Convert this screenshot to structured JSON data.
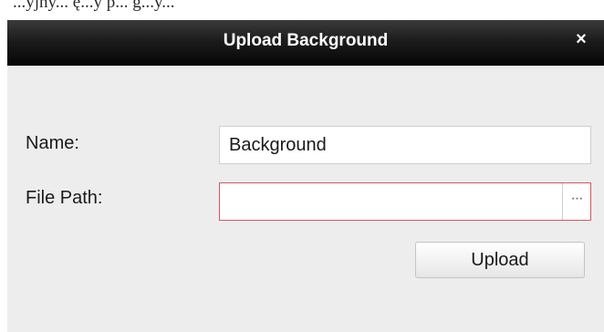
{
  "background_fragment": "...yjny... ę...y p... g...y...",
  "dialog": {
    "title": "Upload Background",
    "close_symbol": "×",
    "name_label": "Name:",
    "name_value": "Background",
    "file_path_label": "File Path:",
    "file_path_value": "",
    "browse_symbol": "···",
    "upload_label": "Upload",
    "colors": {
      "titlebar": "#0a0a0a",
      "dialog_bg": "#ededed",
      "error_border": "#d9555a"
    }
  }
}
